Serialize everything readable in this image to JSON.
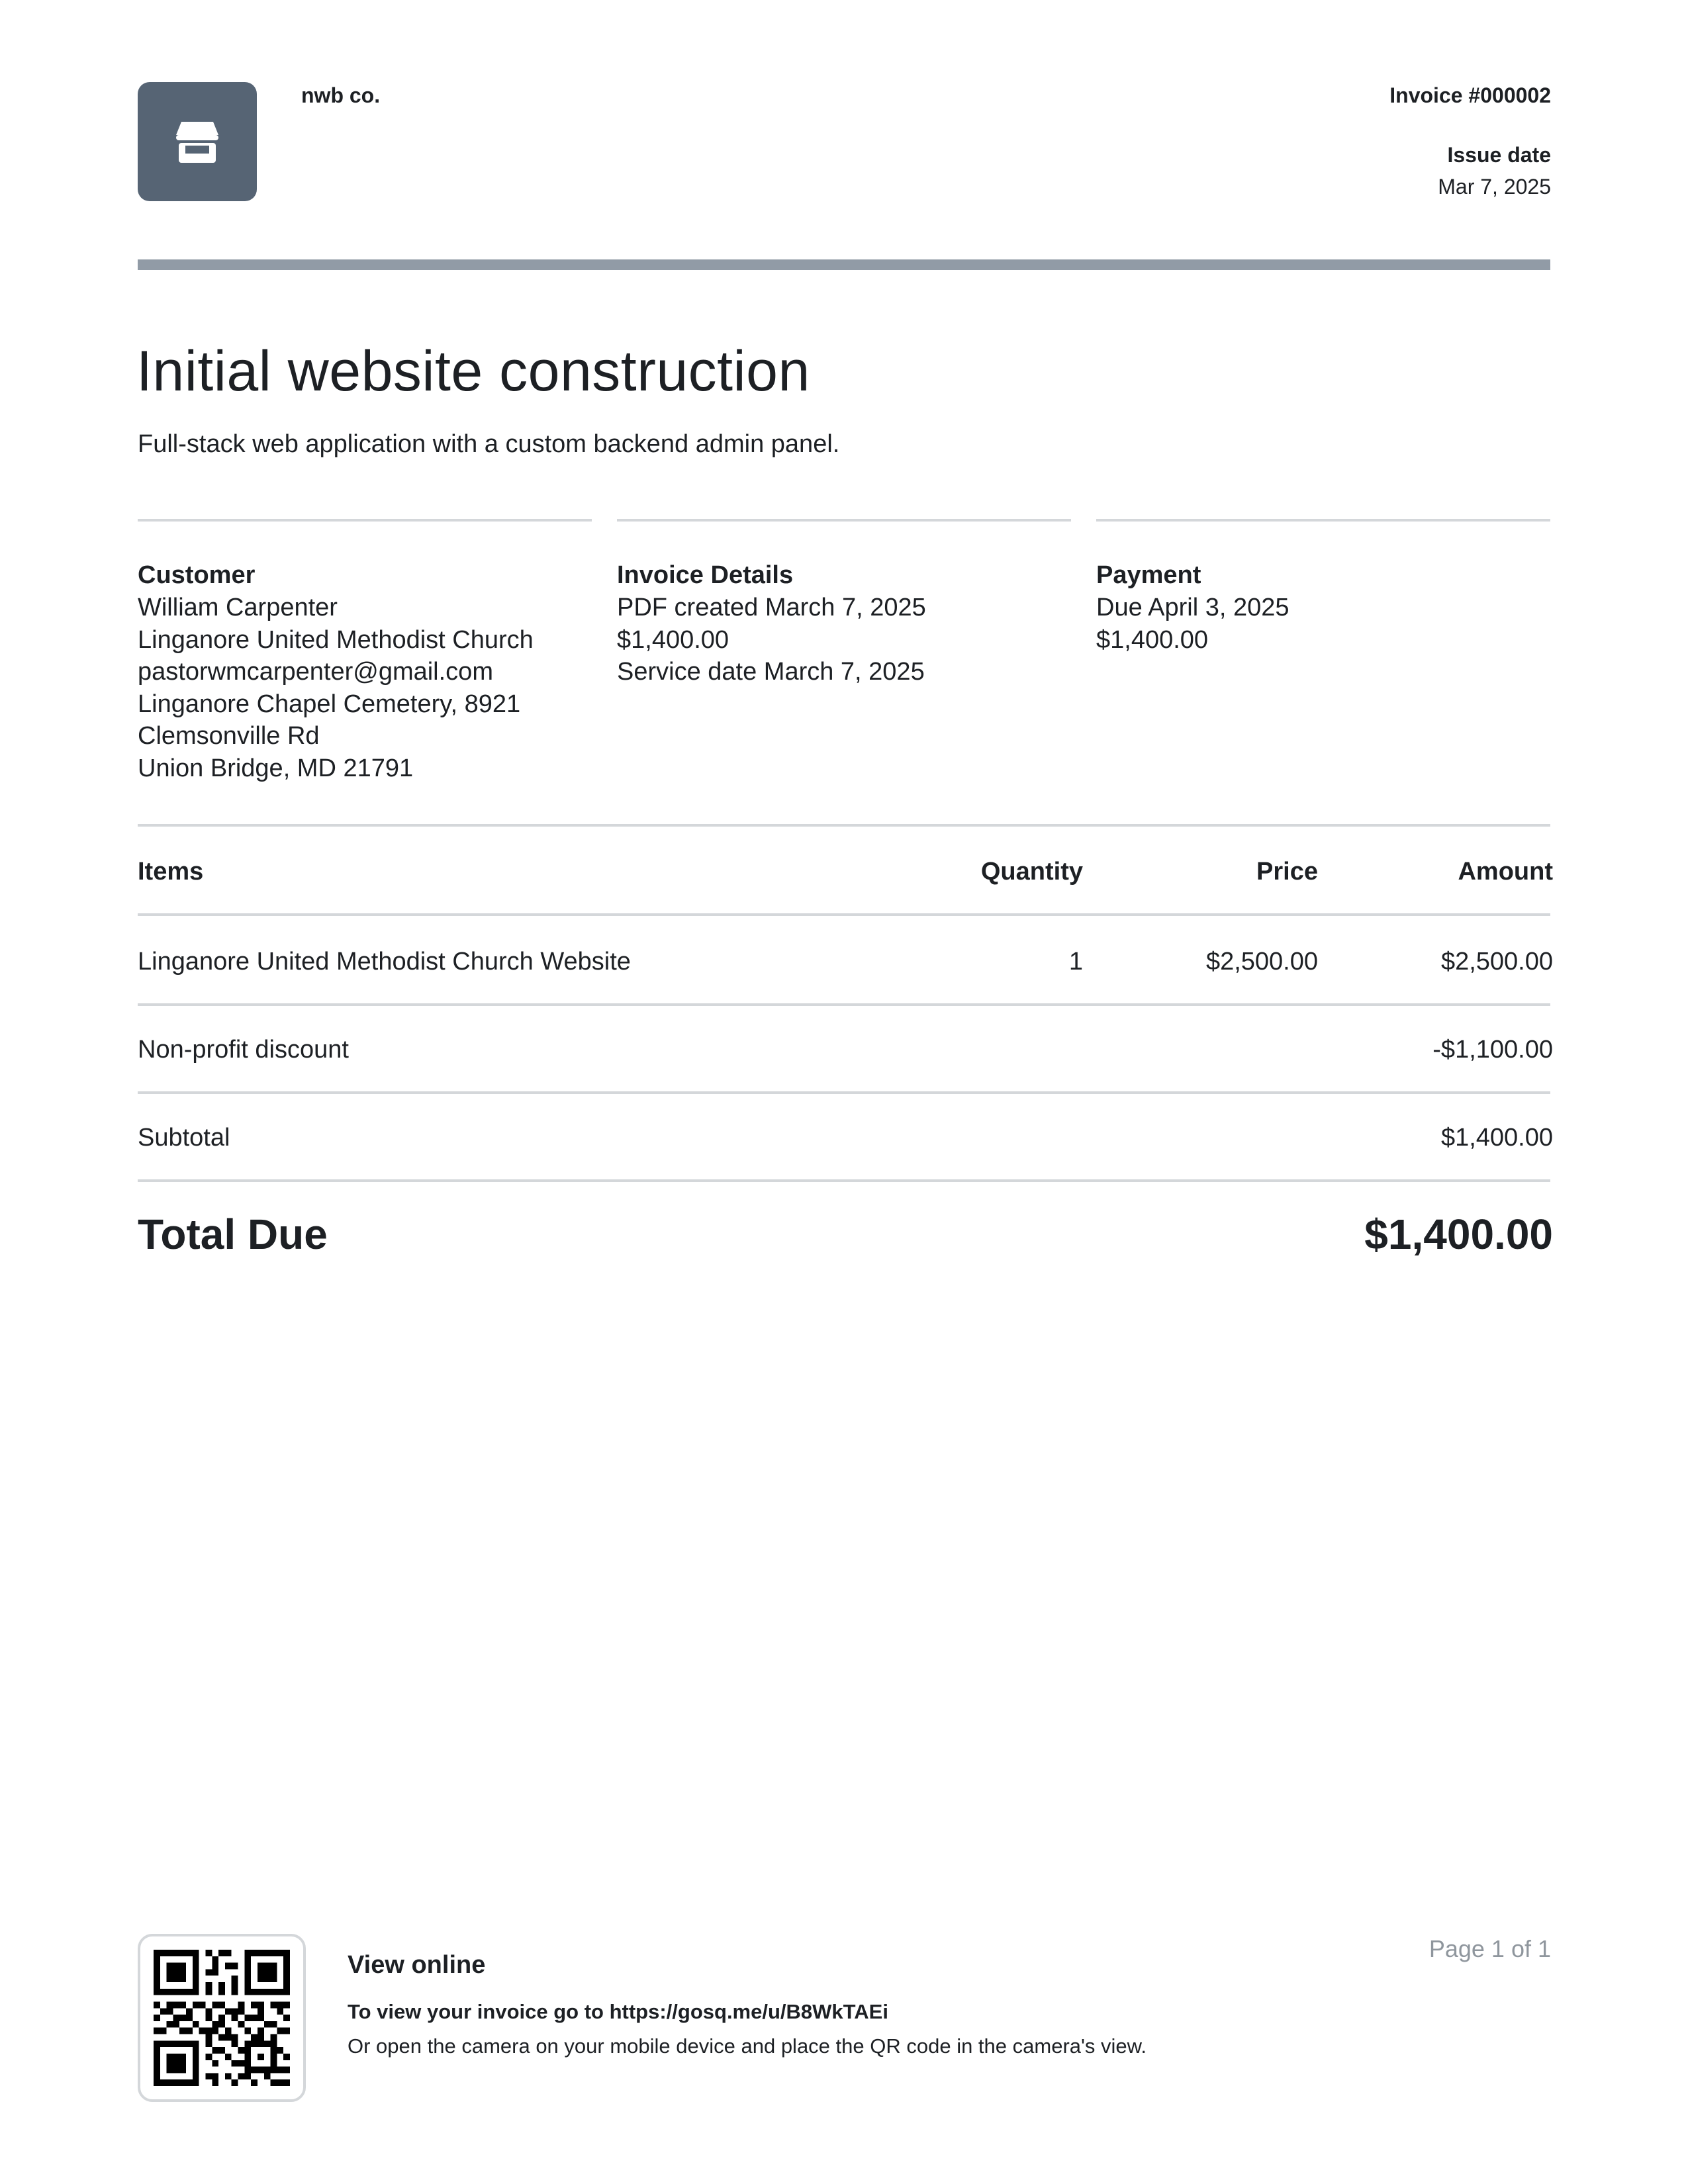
{
  "header": {
    "logo_icon": "storefront-icon",
    "company_name": "nwb co.",
    "invoice_number": "Invoice #000002",
    "issue_date_label": "Issue date",
    "issue_date": "Mar 7, 2025"
  },
  "title": "Initial website construction",
  "subtitle": "Full-stack web application with a custom backend admin panel.",
  "customer": {
    "heading": "Customer",
    "lines": [
      "William Carpenter",
      "Linganore United Methodist Church",
      "pastorwmcarpenter@gmail.com",
      "Linganore Chapel Cemetery, 8921",
      "Clemsonville Rd",
      "Union Bridge, MD 21791"
    ]
  },
  "invoice_details": {
    "heading": "Invoice Details",
    "lines": [
      "PDF created March 7, 2025",
      "$1,400.00",
      "Service date March 7, 2025"
    ]
  },
  "payment": {
    "heading": "Payment",
    "lines": [
      "Due April 3, 2025",
      "$1,400.00"
    ]
  },
  "table": {
    "headers": {
      "items": "Items",
      "quantity": "Quantity",
      "price": "Price",
      "amount": "Amount"
    },
    "rows": [
      {
        "item": "Linganore United Methodist Church Website",
        "quantity": "1",
        "price": "$2,500.00",
        "amount": "$2,500.00"
      }
    ],
    "discount": {
      "label": "Non-profit discount",
      "amount": "-$1,100.00"
    },
    "subtotal": {
      "label": "Subtotal",
      "amount": "$1,400.00"
    },
    "total": {
      "label": "Total Due",
      "amount": "$1,400.00"
    }
  },
  "footer": {
    "qr_icon": "qr-code",
    "view_online_label": "View online",
    "view_link_text": "To view your invoice go to https://gosq.me/u/B8WkTAEi",
    "view_note": "Or open the camera on your mobile device and place the QR code in the camera's view.",
    "page_number": "Page 1 of 1"
  },
  "colors": {
    "logo_background": "#566474",
    "accent_rule": "#919ba6",
    "divider": "#d4d7da",
    "text": "#1d2024",
    "muted_text": "#8f969d"
  }
}
